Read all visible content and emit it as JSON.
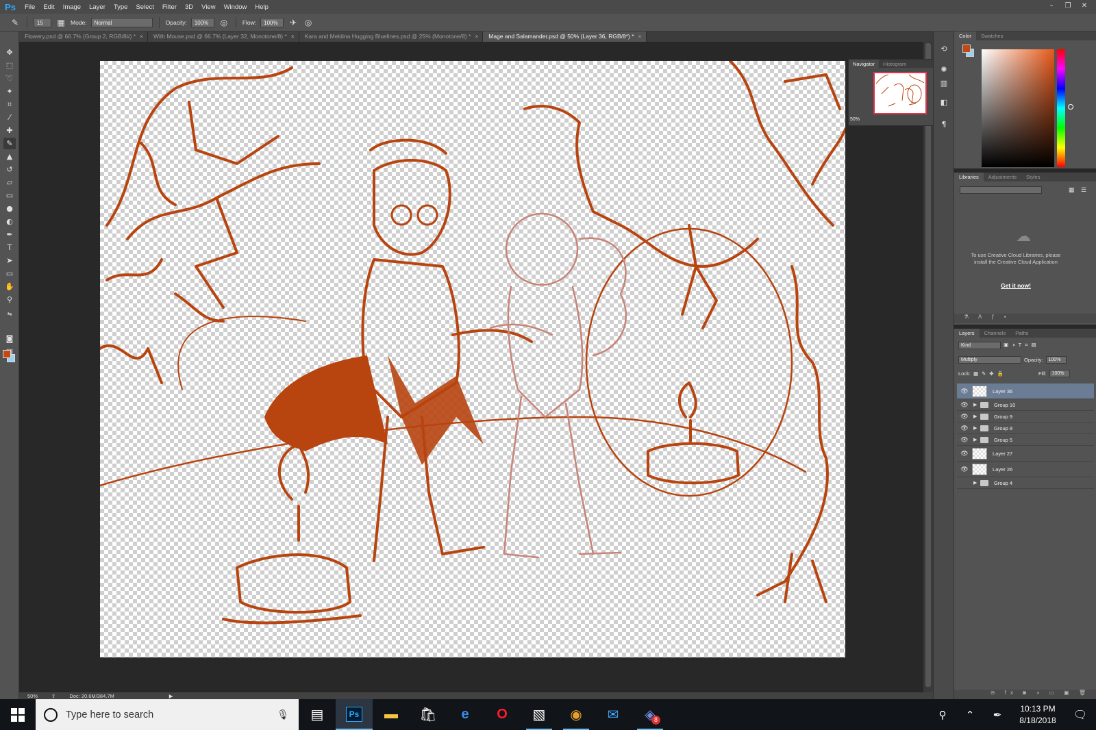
{
  "app": {
    "logo": "Ps"
  },
  "menu": [
    "File",
    "Edit",
    "Image",
    "Layer",
    "Type",
    "Select",
    "Filter",
    "3D",
    "View",
    "Window",
    "Help"
  ],
  "window_controls": [
    "minimize-icon",
    "restore-icon",
    "close-icon"
  ],
  "options_bar": {
    "brush_size": "15",
    "mode_label": "Mode:",
    "mode_value": "Normal",
    "opacity_label": "Opacity:",
    "opacity_value": "100%",
    "flow_label": "Flow:",
    "flow_value": "100%"
  },
  "tabs": [
    {
      "label": "Flowery.psd @ 66.7% (Group 2, RGB/8#) *",
      "close": "×",
      "active": false
    },
    {
      "label": "With Mouse.psd @ 66.7% (Layer 32, Monotone/8) *",
      "close": "×",
      "active": false
    },
    {
      "label": "Kara and Meldina Hugging Bluelines.psd @ 25% (Monotone/8) *",
      "close": "×",
      "active": false
    },
    {
      "label": "Mage and Salamander.psd @ 50% (Layer 36, RGB/8*) *",
      "close": "×",
      "active": true
    }
  ],
  "status": {
    "zoom": "50%",
    "doc": "Doc: 20.6M/384.7M"
  },
  "navigator": {
    "tabs": [
      "Navigator",
      "Histogram"
    ],
    "zoom": "50%"
  },
  "color_panel": {
    "tabs": [
      "Color",
      "Swatches"
    ],
    "fg_color": "#c14a12",
    "bg_color": "#9bd0f0"
  },
  "libraries": {
    "tabs": [
      "Libraries",
      "Adjustments",
      "Styles"
    ],
    "message": "To use Creative Cloud Libraries, please install the Creative Cloud Application",
    "link": "Get it now!"
  },
  "layers_panel": {
    "tabs": [
      "Layers",
      "Channels",
      "Paths"
    ],
    "filter": "Kind",
    "blend_mode": "Multiply",
    "opacity_label": "Opacity:",
    "opacity": "100%",
    "lock_label": "Lock:",
    "fill_label": "Fill:",
    "fill": "100%",
    "layers": [
      {
        "name": "Layer 36",
        "type": "layer",
        "visible": true,
        "selected": true
      },
      {
        "name": "Group 10",
        "type": "group",
        "visible": true,
        "selected": false
      },
      {
        "name": "Group 9",
        "type": "group",
        "visible": true,
        "selected": false
      },
      {
        "name": "Group 8",
        "type": "group",
        "visible": true,
        "selected": false
      },
      {
        "name": "Group 5",
        "type": "group",
        "visible": true,
        "selected": false
      },
      {
        "name": "Layer 27",
        "type": "layer",
        "visible": true,
        "selected": false
      },
      {
        "name": "Layer 26",
        "type": "layer",
        "visible": true,
        "selected": false
      },
      {
        "name": "Group 4",
        "type": "group",
        "visible": false,
        "selected": false
      }
    ]
  },
  "taskbar": {
    "search_placeholder": "Type here to search",
    "apps": [
      "task-view-icon",
      "photoshop-icon",
      "file-explorer-icon",
      "store-icon",
      "edge-icon",
      "opera-icon",
      "app-icon",
      "chrome-icon",
      "outlook-icon",
      "discord-icon"
    ],
    "discord_badge": "8",
    "time": "10:13 PM",
    "date": "8/18/2018"
  },
  "colors": {
    "sketch": "#b8440f",
    "sketch_light": "#c88478",
    "accent_ps": "#31a8ff"
  }
}
